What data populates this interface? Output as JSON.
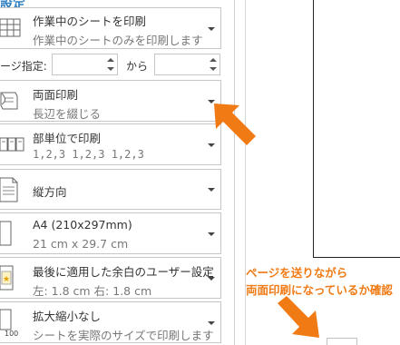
{
  "heading_fragment": "設定",
  "print_scope": {
    "main": "作業中のシートを印刷",
    "sub": "作業中のシートのみを印刷します"
  },
  "pages": {
    "label": "ージ指定:",
    "from_value": "",
    "to_value": "",
    "separator": "から"
  },
  "duplex": {
    "main": "両面印刷",
    "sub": "長辺を綴じる"
  },
  "collate": {
    "main": "部単位で印刷",
    "sub": "1,2,3    1,2,3    1,2,3"
  },
  "orientation": {
    "main": "縦方向"
  },
  "paper_size": {
    "main": "A4 (210x297mm)",
    "sub": "21 cm x 29.7 cm"
  },
  "margins": {
    "main": "最後に適用した余白のユーザー設定",
    "sub": "左:  1.8 cm    右:  1.8 cm"
  },
  "scaling": {
    "main": "拡大縮小なし",
    "sub": "シートを実際のサイズで印刷します"
  },
  "annotation": {
    "line1": "ページを送りながら",
    "line2": "両面印刷になっているか確認"
  },
  "colors": {
    "annotation": "#f07a14",
    "border": "#c6c6c6",
    "heading": "#2f7fc1"
  },
  "icons": {
    "print_scope": "sheet-grid-icon",
    "duplex": "duplex-print-icon",
    "collate": "collate-pages-icon",
    "orientation": "portrait-page-icon",
    "paper_size": "paper-size-icon",
    "margins": "margins-icon",
    "scaling": "scaling-100-icon"
  }
}
